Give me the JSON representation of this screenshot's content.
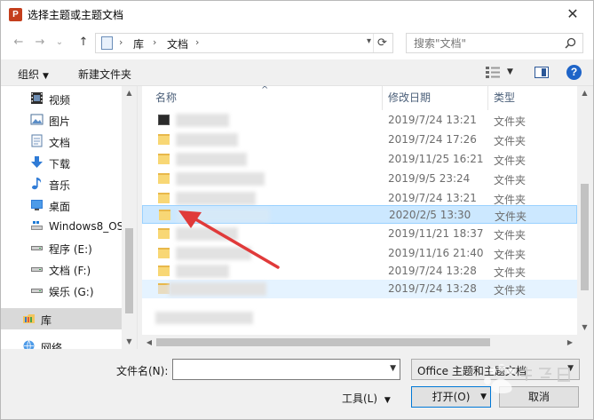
{
  "window": {
    "title": "选择主题或主题文档",
    "app_icon_letter": "P",
    "close_glyph": "✕"
  },
  "nav": {
    "back_glyph": "←",
    "forward_glyph": "→",
    "recent_glyph": "⌄",
    "up_glyph": "↑",
    "address_parts": [
      "库",
      "文档"
    ],
    "address_sep": "›",
    "search_placeholder": "搜索\"文档\""
  },
  "toolbar": {
    "organize_label": "组织",
    "new_folder_label": "新建文件夹",
    "help_label": "?"
  },
  "sidebar": {
    "items": [
      {
        "label": "视频",
        "icon": "video-icon"
      },
      {
        "label": "图片",
        "icon": "pictures-icon"
      },
      {
        "label": "文档",
        "icon": "documents-icon"
      },
      {
        "label": "下载",
        "icon": "download-icon"
      },
      {
        "label": "音乐",
        "icon": "music-icon"
      },
      {
        "label": "桌面",
        "icon": "desktop-icon"
      },
      {
        "label": "Windows8_OS",
        "icon": "drive-icon"
      },
      {
        "label": "程序 (E:)",
        "icon": "drive-icon"
      },
      {
        "label": "文档 (F:)",
        "icon": "drive-icon"
      },
      {
        "label": "娱乐 (G:)",
        "icon": "drive-icon"
      },
      {
        "label": "库",
        "icon": "library-icon"
      },
      {
        "label": "网络",
        "icon": "network-icon"
      }
    ]
  },
  "filelist": {
    "columns": {
      "name": "名称",
      "date": "修改日期",
      "type": "类型"
    },
    "rows": [
      {
        "date": "2019/7/24 13:21",
        "type": "文件夹"
      },
      {
        "date": "2019/7/24 17:26",
        "type": "文件夹"
      },
      {
        "date": "2019/11/25 16:21",
        "type": "文件夹"
      },
      {
        "date": "2019/9/5 23:24",
        "type": "文件夹"
      },
      {
        "date": "2019/7/24 13:21",
        "type": "文件夹"
      },
      {
        "date": "2020/2/5 13:30",
        "type": "文件夹"
      },
      {
        "date": "2019/11/21 18:37",
        "type": "文件夹"
      },
      {
        "date": "2019/11/16 21:40",
        "type": "文件夹"
      },
      {
        "date": "2019/7/24 13:28",
        "type": "文件夹"
      },
      {
        "date": "2019/7/24 13:28",
        "type": "文件夹"
      }
    ]
  },
  "bottom": {
    "filename_label": "文件名(N):",
    "filename_value": "",
    "filter_value": "Office 主题和主题文档",
    "tools_label": "工具(L)",
    "open_label": "打开(O)",
    "cancel_label": "取消"
  },
  "colors": {
    "accent": "#0078d7",
    "selection": "#cce8ff",
    "annotation_arrow": "#e03a3a"
  }
}
